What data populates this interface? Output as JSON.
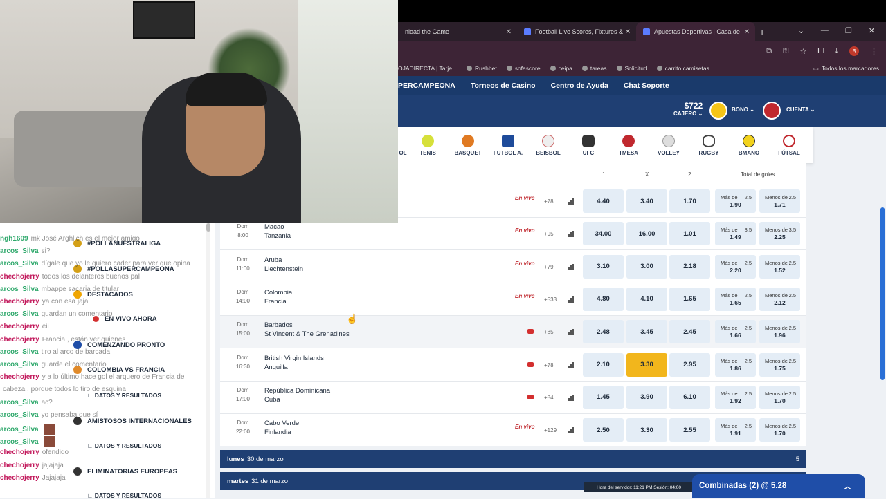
{
  "browser": {
    "tabs": [
      {
        "label": "nload the Game"
      },
      {
        "label": "Football Live Scores, Fixtures &"
      },
      {
        "label": "Apuestas Deportivas | Casa de"
      }
    ],
    "new_tab": "+",
    "avatar_letter": "B",
    "bookmarks": [
      "OJADIRECTA | Tarje...",
      "Rushbet",
      "sofascore",
      "ceipa",
      "tareas",
      "Solicitud",
      "carrito camisetas"
    ],
    "all_bookmarks": "Todos los marcadores"
  },
  "site": {
    "nav": [
      "PERCAMPEONA",
      "Torneos de Casino",
      "Centro de Ayuda",
      "Chat Soporte"
    ],
    "balance": "$722",
    "cashier": "CAJERO",
    "bono": "BONO",
    "cuenta": "CUENTA"
  },
  "sports": [
    "OL",
    "TENIS",
    "BASQUET",
    "FUTBOL A.",
    "BEISBOL",
    "UFC",
    "TMESA",
    "VOLLEY",
    "RUGBY",
    "BMANO",
    "FÚTSAL"
  ],
  "sports_colors": {
    "tenis": "#d6e03a",
    "basquet": "#e07a22",
    "futbol": "#1e4b9a",
    "beisbol": "#eeeeee",
    "ufc": "#333333",
    "tmesa": "#c0282e",
    "volley": "#dddddd",
    "rugby": "#8a5a3a",
    "bmano": "#f2d21c",
    "futsal": "#c0282e"
  },
  "columns": {
    "c1": "1",
    "cx": "X",
    "c2": "2",
    "total": "Total de goles"
  },
  "sidebar": [
    {
      "label": "#POLLANUESTRALIGA",
      "icon": "trophy-icon"
    },
    {
      "label": "#POLLASUPERCAMPEONA",
      "icon": "trophy-icon"
    },
    {
      "label": "DESTACADOS",
      "icon": "star-icon"
    },
    {
      "label": "EN VIVO AHORA",
      "icon": "live-icon"
    },
    {
      "label": "COMENZANDO PRONTO",
      "icon": "clock-icon"
    },
    {
      "label": "COLOMBIA VS FRANCIA",
      "icon": "flag-icon"
    },
    {
      "label": "DATOS Y RESULTADOS",
      "icon": ""
    },
    {
      "label": "AMISTOSOS INTERNACIONALES",
      "icon": "ball-icon"
    },
    {
      "label": "DATOS Y RESULTADOS",
      "icon": ""
    },
    {
      "label": "ELIMINATORIAS EUROPEAS",
      "icon": "ball-icon"
    },
    {
      "label": "DATOS Y RESULTADOS",
      "icon": ""
    }
  ],
  "chat": [
    {
      "user": "ngh1609",
      "msg": "mk José Arghlich es el mejor amigo",
      "color": "#2ea86b"
    },
    {
      "user": "arcos_Silva",
      "msg": "si?",
      "color": "#2ea86b"
    },
    {
      "user": "arcos_Silva",
      "msg": "dígale que yo le quiero cader para ver que opina",
      "color": "#2ea86b"
    },
    {
      "user": "chechojerry",
      "msg": "todos los delanteros buenos pal",
      "color": "#c2185b"
    },
    {
      "user": "arcos_Silva",
      "msg": "mbappe sacaria de titular",
      "color": "#2ea86b"
    },
    {
      "user": "chechojerry",
      "msg": "ya con esa jaja",
      "color": "#c2185b"
    },
    {
      "user": "arcos_Silva",
      "msg": "guardan un comentario",
      "color": "#2ea86b"
    },
    {
      "user": "chechojerry",
      "msg": "eii",
      "color": "#c2185b"
    },
    {
      "user": "chechojerry",
      "msg": "Francia , están ver quienes",
      "color": "#c2185b"
    },
    {
      "user": "arcos_Silva",
      "msg": "tiro al arco de barcada",
      "color": "#2ea86b"
    },
    {
      "user": "arcos_Silva",
      "msg": "guarde el comentario",
      "color": "#2ea86b"
    },
    {
      "user": "chechojerry",
      "msg": "y a lo último hace gol el arquero de Francia de",
      "color": "#c2185b"
    },
    {
      "user": "",
      "msg": "cabeza , porque todos lo tiro de esquina",
      "color": "#c2185b"
    },
    {
      "user": "arcos_Silva",
      "msg": "ac?",
      "color": "#2ea86b"
    },
    {
      "user": "arcos_Silva",
      "msg": "yo pensaba que sí",
      "color": "#2ea86b"
    },
    {
      "user": "arcos_Silva",
      "msg": "",
      "color": "#2ea86b"
    },
    {
      "user": "arcos_Silva",
      "msg": "",
      "color": "#2ea86b"
    },
    {
      "user": "chechojerry",
      "msg": "ofendido",
      "color": "#c2185b"
    },
    {
      "user": "chechojerry",
      "msg": "jajajaja",
      "color": "#c2185b"
    },
    {
      "user": "chechojerry",
      "msg": "Jajajaja",
      "color": "#c2185b"
    }
  ],
  "matches": [
    {
      "day": "",
      "time": "",
      "team1": "",
      "team2": "",
      "live": "En vivo",
      "more": "+78",
      "o1": "4.40",
      "ox": "3.40",
      "o2": "1.70",
      "over_line": "2.5",
      "over": "1.90",
      "under_line": "2.5",
      "under": "1.71",
      "selected": false
    },
    {
      "day": "Dom",
      "time": "8:00",
      "team1": "Macao",
      "team2": "Tanzania",
      "live": "En vivo",
      "more": "+95",
      "o1": "34.00",
      "ox": "16.00",
      "o2": "1.01",
      "over_line": "3.5",
      "over": "1.49",
      "under_line": "3.5",
      "under": "2.25",
      "selected": false
    },
    {
      "day": "Dom",
      "time": "11:00",
      "team1": "Aruba",
      "team2": "Liechtenstein",
      "live": "En vivo",
      "more": "+79",
      "o1": "3.10",
      "ox": "3.00",
      "o2": "2.18",
      "over_line": "2.5",
      "over": "2.20",
      "under_line": "2.5",
      "under": "1.52",
      "selected": false
    },
    {
      "day": "Dom",
      "time": "14:00",
      "team1": "Colombia",
      "team2": "Francia",
      "live": "En vivo",
      "more": "+533",
      "o1": "4.80",
      "ox": "4.10",
      "o2": "1.65",
      "over_line": "2.5",
      "over": "1.65",
      "under_line": "2.5",
      "under": "2.12",
      "selected": false
    },
    {
      "day": "Dom",
      "time": "15:00",
      "team1": "Barbados",
      "team2": "St Vincent & The Grenadines",
      "live": "",
      "more": "+85",
      "o1": "2.48",
      "ox": "3.45",
      "o2": "2.45",
      "over_line": "2.5",
      "over": "1.66",
      "under_line": "2.5",
      "under": "1.96",
      "selected": false
    },
    {
      "day": "Dom",
      "time": "16:30",
      "team1": "British Virgin Islands",
      "team2": "Anguilla",
      "live": "",
      "more": "+78",
      "o1": "2.10",
      "ox": "3.30",
      "o2": "2.95",
      "over_line": "2.5",
      "over": "1.86",
      "under_line": "2.5",
      "under": "1.75",
      "selected": true
    },
    {
      "day": "Dom",
      "time": "17:00",
      "team1": "República Dominicana",
      "team2": "Cuba",
      "live": "",
      "more": "+84",
      "o1": "1.45",
      "ox": "3.90",
      "o2": "6.10",
      "over_line": "2.5",
      "over": "1.92",
      "under_line": "2.5",
      "under": "1.70",
      "selected": false
    },
    {
      "day": "Dom",
      "time": "22:00",
      "team1": "Cabo Verde",
      "team2": "Finlandia",
      "live": "En vivo",
      "more": "+129",
      "o1": "2.50",
      "ox": "3.30",
      "o2": "2.55",
      "over_line": "2.5",
      "over": "1.91",
      "under_line": "2.5",
      "under": "1.70",
      "selected": false
    }
  ],
  "labels": {
    "mas": "Más de",
    "menos": "Menos de"
  },
  "daybars": [
    {
      "day": "lunes",
      "date": "30 de marzo",
      "count": "5"
    },
    {
      "day": "martes",
      "date": "31 de marzo",
      "count": ""
    }
  ],
  "server": "Hora del servidor: 11:21 PM   Sesión: 04:00",
  "combi": "Combinadas (2) @ 5.28"
}
